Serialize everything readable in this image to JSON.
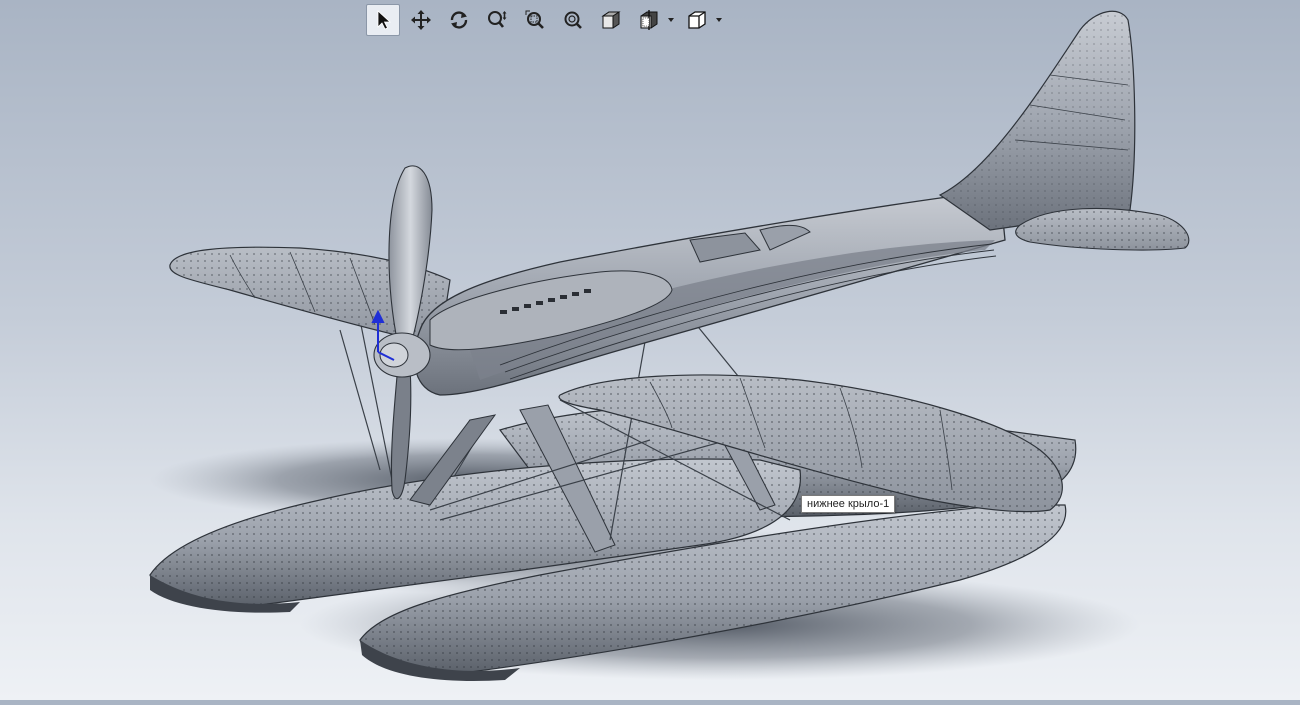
{
  "toolbar": {
    "buttons": [
      {
        "name": "select",
        "icon": "cursor-arrow-icon",
        "active": true
      },
      {
        "name": "pan",
        "icon": "move-arrows-icon"
      },
      {
        "name": "rotate",
        "icon": "rotate-view-icon"
      },
      {
        "name": "zoom-dynamic",
        "icon": "zoom-in-out-icon"
      },
      {
        "name": "zoom-to-area",
        "icon": "zoom-area-icon"
      },
      {
        "name": "zoom-to-fit",
        "icon": "zoom-fit-icon"
      },
      {
        "name": "display-style",
        "icon": "shaded-cube-icon"
      },
      {
        "name": "section-view",
        "icon": "section-cube-icon",
        "dropdown": true
      },
      {
        "name": "view-orientation",
        "icon": "wireframe-cube-icon",
        "dropdown": true
      }
    ]
  },
  "model": {
    "hover_tooltip": "нижнее крыло-1"
  },
  "colors": {
    "model_surface": "#9ea4ae",
    "model_edge": "#2e333a",
    "background_top": "#a9b4c4",
    "background_bottom": "#eef1f5",
    "triad_blue": "#1f2fd6"
  }
}
